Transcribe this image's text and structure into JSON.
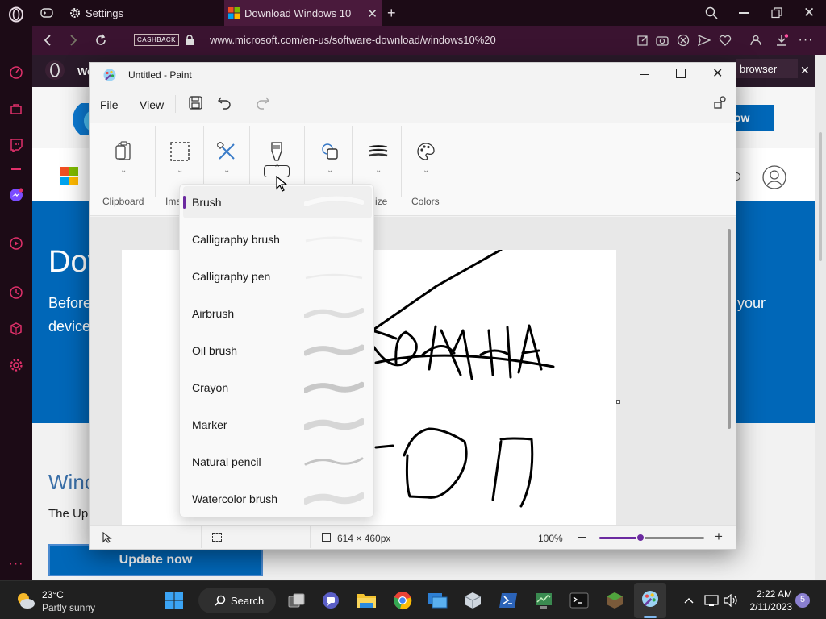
{
  "browser": {
    "tabs": [
      {
        "label": "Settings"
      },
      {
        "label": "Download Windows 10"
      }
    ],
    "cashback_label": "CASHBACK",
    "url": "www.microsoft.com/en-us/software-download/windows10%20"
  },
  "webpage": {
    "banner_fragment": "We",
    "browser_badge": "browser",
    "blue_button_fragment": "ow",
    "heading_fragment": "Dov",
    "intro_line1_fragment": "Before",
    "intro_line2_fragment": "device",
    "intro_right_fragment": "your",
    "section_heading_fragment": "Winc",
    "section_text_fragment": "The Up",
    "update_button": "Update now"
  },
  "paint": {
    "title": "Untitled - Paint",
    "menu": {
      "file": "File",
      "view": "View"
    },
    "ribbon_groups": {
      "clipboard": "Clipboard",
      "image_fragment": "Ima",
      "size_fragment": "ize",
      "colors": "Colors"
    },
    "brushes": [
      {
        "label": "Brush",
        "selected": true
      },
      {
        "label": "Calligraphy brush"
      },
      {
        "label": "Calligraphy pen"
      },
      {
        "label": "Airbrush"
      },
      {
        "label": "Oil brush"
      },
      {
        "label": "Crayon"
      },
      {
        "label": "Marker"
      },
      {
        "label": "Natural pencil"
      },
      {
        "label": "Watercolor brush"
      }
    ],
    "status": {
      "canvas_size": "614 × 460px",
      "zoom": "100%"
    },
    "accent_color": "#6b2aa0"
  },
  "taskbar": {
    "weather_temp": "23°C",
    "weather_desc": "Partly sunny",
    "search_label": "Search",
    "time": "2:22 AM",
    "date": "2/11/2023",
    "notification_count": "5"
  },
  "colors": {
    "opera_bg": "#1c0b16",
    "address_bar": "#3a1330",
    "ms_blue": "#0067b8",
    "taskbar": "#202020"
  }
}
